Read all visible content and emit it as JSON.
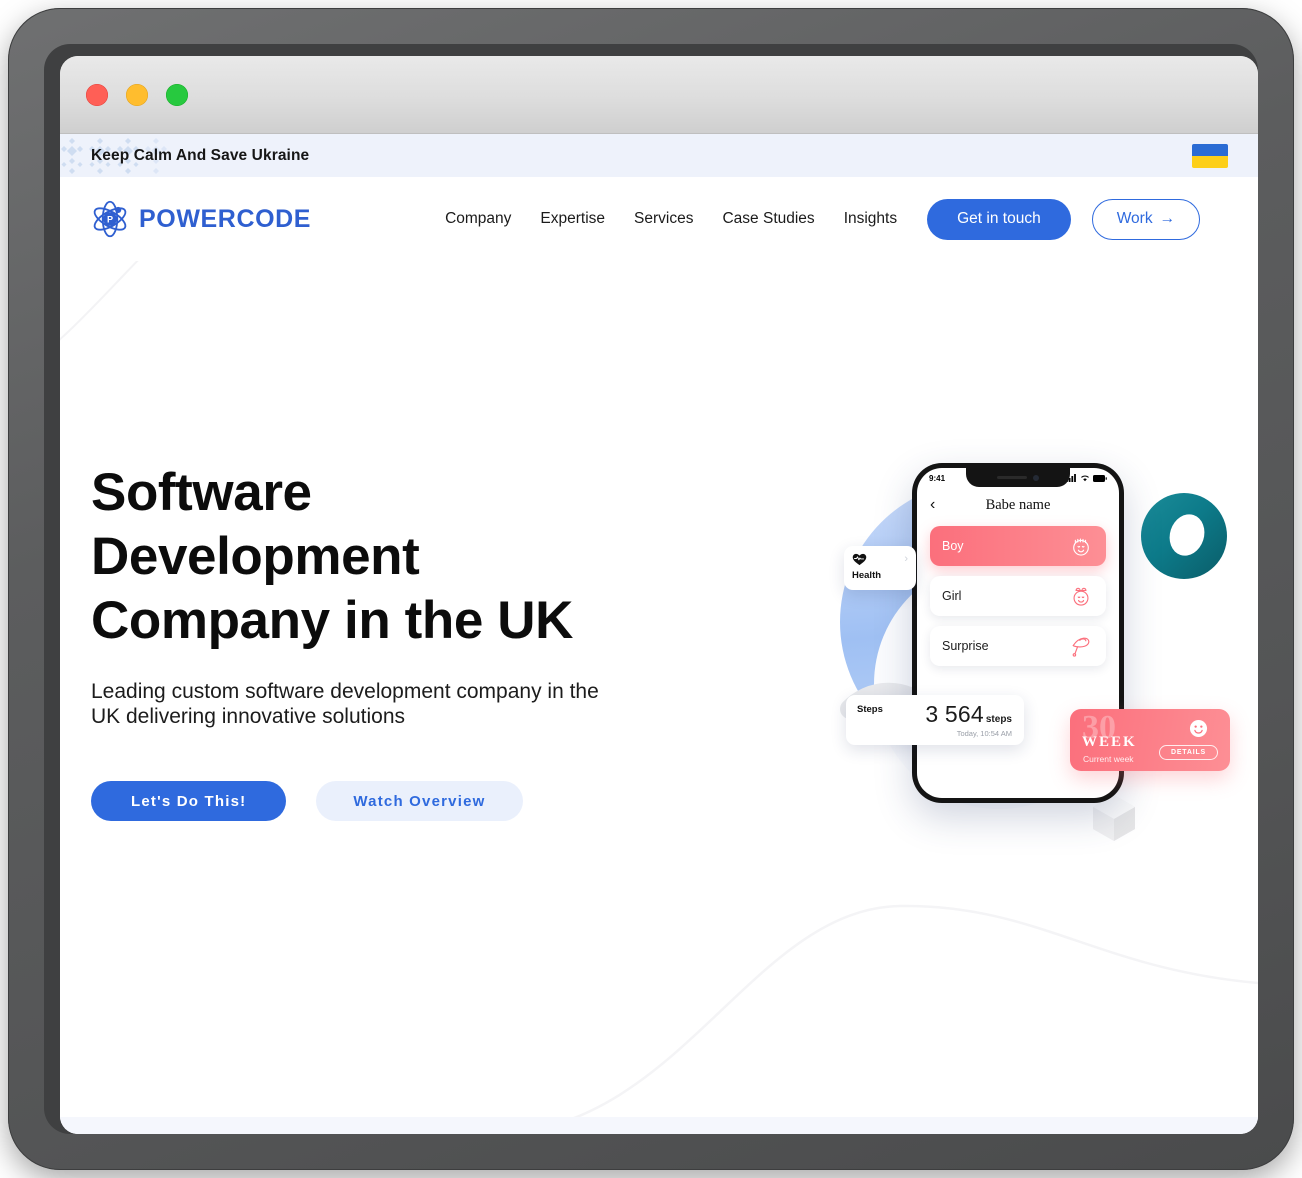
{
  "window": {
    "traffic_lights": [
      "close",
      "minimize",
      "maximize"
    ],
    "colors": {
      "close": "#ff5f56",
      "minimize": "#ffbd2e",
      "maximize": "#27c93f"
    }
  },
  "banner": {
    "text": "Keep Calm And Save Ukraine",
    "flag_alt": "Ukraine flag",
    "flag_colors": {
      "top": "#2b6cd4",
      "bottom": "#fdcf19"
    },
    "background": "#eef2fb"
  },
  "header": {
    "logo_text": "POWERCODE",
    "logo_color": "#2f5fd0",
    "nav": [
      {
        "label": "Company"
      },
      {
        "label": "Expertise"
      },
      {
        "label": "Services"
      },
      {
        "label": "Case Studies"
      },
      {
        "label": "Insights"
      }
    ],
    "cta_primary": "Get in touch",
    "cta_secondary": "Work",
    "cta_secondary_arrow": "→",
    "accent": "#2f6ade"
  },
  "hero": {
    "title_line1": "Software",
    "title_line2": "Development",
    "title_line3": "Company in the UK",
    "subtitle": "Leading custom software development company in the UK delivering innovative solutions",
    "btn_primary": "Let's Do This!",
    "btn_secondary": "Watch Overview",
    "btn_primary_color": "#2f6ade",
    "btn_secondary_bg": "#eaf0fc"
  },
  "illustration": {
    "phone": {
      "status_time": "9:41",
      "app_title": "Babe name",
      "back_glyph": "‹",
      "options": [
        {
          "label": "Boy",
          "icon": "baby-boy-face-icon",
          "selected": true
        },
        {
          "label": "Girl",
          "icon": "baby-girl-face-icon",
          "selected": false
        },
        {
          "label": "Surprise",
          "icon": "sun-hat-icon",
          "selected": false
        }
      ],
      "selected_color": "#fb6f7c"
    },
    "health_card": {
      "label": "Health",
      "icon": "heart-pulse-icon",
      "chevron": "›"
    },
    "steps_card": {
      "label": "Steps",
      "value": "3 564",
      "unit": "steps",
      "timestamp": "Today, 10:54 AM"
    },
    "week_card": {
      "number": "30",
      "word": "WEEK",
      "subtitle": "Current week",
      "details_label": "DETAILS",
      "icon": "smiley-face-icon",
      "color": "#fb6f7c"
    },
    "shapes": {
      "torus_color": "#0d7b8a",
      "blob_color": "#9fc0f3",
      "arc_color": "#e8e9ec",
      "cube_color": "#ededed"
    }
  }
}
